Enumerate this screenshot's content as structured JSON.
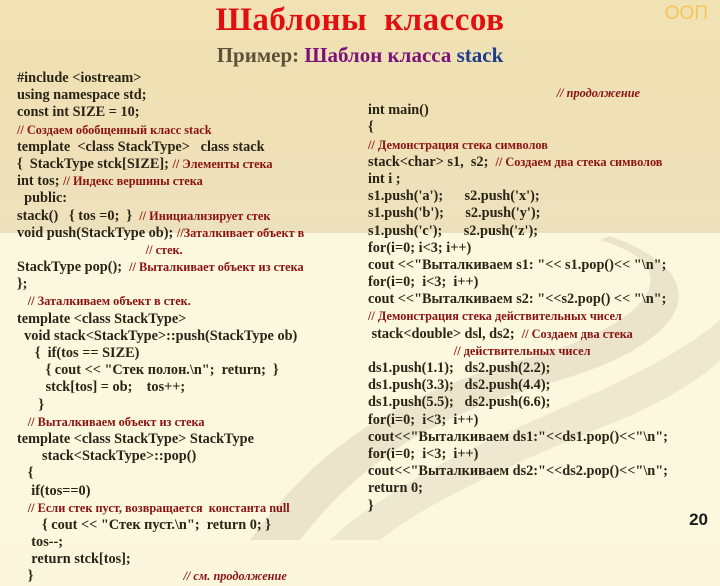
{
  "slide": {
    "title": "Шаблоны  классов",
    "corner_label": "ООП",
    "subtitle": {
      "prefix": "Пример: ",
      "middle": "Шаблон класса ",
      "suffix": "stack"
    },
    "page_number": "20"
  },
  "left_code": [
    {
      "code": "#include <iostream>",
      "comment": "",
      "indent": ""
    },
    {
      "code": "using namespace std;",
      "comment": "",
      "indent": ""
    },
    {
      "code": "const int SIZE = 10;",
      "comment": "",
      "indent": ""
    },
    {
      "code": "",
      "comment": "// Создаем обобщенный класс stack",
      "indent": ""
    },
    {
      "code": "template  <class StackType>   class stack",
      "comment": "",
      "indent": ""
    },
    {
      "code": "{  StackType stck[SIZE]; ",
      "comment": "// Элементы стека",
      "indent": ""
    },
    {
      "code": "int tos; ",
      "comment": "// Индекс вершины стека",
      "indent": ""
    },
    {
      "code": "public:",
      "comment": "",
      "indent": "  "
    },
    {
      "code": "stack()   { tos =0;  }  ",
      "comment": "// Инициализирует стек",
      "indent": ""
    },
    {
      "code": "void push(StackType ob); ",
      "comment": "//Заталкивает объект в",
      "indent": ""
    },
    {
      "code": "",
      "comment": "// стек.",
      "indent": "                                    "
    },
    {
      "code": "StackType pop();  ",
      "comment": "// Выталкивает объект из стека",
      "indent": ""
    },
    {
      "code": "};",
      "comment": "",
      "indent": ""
    },
    {
      "code": "",
      "comment": "// Заталкиваем объект в стек.",
      "indent": "   "
    },
    {
      "code": "template <class StackType>",
      "comment": "",
      "indent": ""
    },
    {
      "code": "void stack<StackType>::push(StackType ob)",
      "comment": "",
      "indent": "  "
    },
    {
      "code": "{  if(tos == SIZE)",
      "comment": "",
      "indent": "     "
    },
    {
      "code": "{ cout << \"Стек полон.\\n\";  return;  }",
      "comment": "",
      "indent": "        "
    },
    {
      "code": "stck[tos] = ob;    tos++;",
      "comment": "",
      "indent": "        "
    },
    {
      "code": "}",
      "comment": "",
      "indent": "      "
    },
    {
      "code": "",
      "comment": "// Выталкиваем объект из стека",
      "indent": "   "
    },
    {
      "code": "template <class StackType> StackType",
      "comment": "",
      "indent": ""
    },
    {
      "code": "stack<StackType>::pop()",
      "comment": "",
      "indent": "       "
    },
    {
      "code": "{",
      "comment": "",
      "indent": "   "
    },
    {
      "code": "if(tos==0)",
      "comment": "",
      "indent": "    "
    },
    {
      "code": "",
      "comment": "// Если стек пуст, возвращается  константа null",
      "indent": "   "
    },
    {
      "code": "{ cout << \"Стек пуст.\\n\";  return 0; }",
      "comment": "",
      "indent": "       "
    },
    {
      "code": "tos--;",
      "comment": "",
      "indent": "    "
    },
    {
      "code": "return stck[tos];",
      "comment": "",
      "indent": "    "
    },
    {
      "code": "}",
      "comment": "",
      "indent": "   "
    }
  ],
  "left_trailer_comment": "// см. продолжение",
  "right_header_comment": "// продолжение",
  "right_code": [
    {
      "code": "int main()",
      "comment": "",
      "indent": ""
    },
    {
      "code": "{",
      "comment": "",
      "indent": ""
    },
    {
      "code": "",
      "comment": "// Демонстрация стека символов",
      "indent": ""
    },
    {
      "code": "stack<char> s1,  s2;  ",
      "comment": "// Создаем два стека символов",
      "indent": ""
    },
    {
      "code": "int i ;",
      "comment": "",
      "indent": ""
    },
    {
      "code": "s1.push('a');      s2.push('x');",
      "comment": "",
      "indent": ""
    },
    {
      "code": "s1.push('b');      s2.push('y');",
      "comment": "",
      "indent": ""
    },
    {
      "code": "s1.push('c');      s2.push('z');",
      "comment": "",
      "indent": ""
    },
    {
      "code": "for(i=0; i<3; i++)",
      "comment": "",
      "indent": ""
    },
    {
      "code": "cout <<\"Выталкиваем s1: \"<< s1.pop()<< \"\\n\";",
      "comment": "",
      "indent": ""
    },
    {
      "code": "for(i=0;  i<3;  i++)",
      "comment": "",
      "indent": ""
    },
    {
      "code": "cout <<\"Выталкиваем s2: \"<<s2.pop() << \"\\n\";",
      "comment": "",
      "indent": ""
    },
    {
      "code": "",
      "comment": "// Демонстрация стека действительных чисел",
      "indent": ""
    },
    {
      "code": "stack<double> dsl, ds2;  ",
      "comment": "// Создаем два стека",
      "indent": " "
    },
    {
      "code": "",
      "comment": "// действительных чисел",
      "indent": "                        "
    },
    {
      "code": "ds1.push(1.1);   ds2.push(2.2);",
      "comment": "",
      "indent": ""
    },
    {
      "code": "ds1.push(3.3);   ds2.push(4.4);",
      "comment": "",
      "indent": ""
    },
    {
      "code": "ds1.push(5.5);   ds2.push(6.6);",
      "comment": "",
      "indent": ""
    },
    {
      "code": "for(i=0;  i<3;  i++)",
      "comment": "",
      "indent": ""
    },
    {
      "code": "cout<<\"Выталкиваем ds1:\"<<ds1.pop()<<\"\\n\";",
      "comment": "",
      "indent": ""
    },
    {
      "code": "for(i=0;  i<3;  i++)",
      "comment": "",
      "indent": ""
    },
    {
      "code": "cout<<\"Выталкиваем ds2:\"<<ds2.pop()<<\"\\n\";",
      "comment": "",
      "indent": ""
    },
    {
      "code": "return 0;",
      "comment": "",
      "indent": ""
    },
    {
      "code": "}",
      "comment": "",
      "indent": ""
    }
  ]
}
